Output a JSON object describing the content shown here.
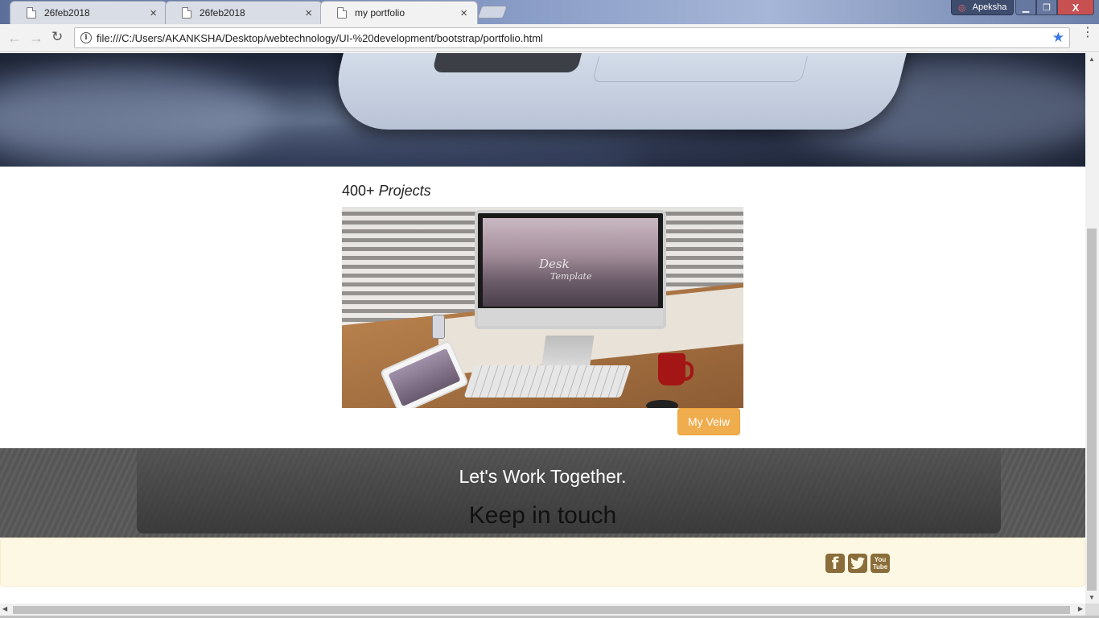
{
  "browser": {
    "tabs": [
      {
        "label": "26feb2018",
        "close": "×"
      },
      {
        "label": "26feb2018",
        "close": "×"
      },
      {
        "label": "my portfolio",
        "close": "×"
      }
    ],
    "profile_name": "Apeksha",
    "window_controls": {
      "minimize": "▁",
      "maximize": "❐",
      "close": "X"
    },
    "nav": {
      "back": "←",
      "forward": "→",
      "reload": "↻"
    },
    "url": "file:///C:/Users/AKANKSHA/Desktop/webtechnology/UI-%20development/bootstrap/portfolio.html",
    "bookmark_star": "★",
    "info_symbol": "i",
    "menu": "⋮"
  },
  "page": {
    "projects": {
      "count": "400+",
      "label": "Projects",
      "image_screen_text_1": "Desk",
      "image_screen_text_2": "Template"
    },
    "view_button": "My Veiw",
    "contact": {
      "heading": "Let's Work Together.",
      "subheading": "Keep in touch"
    },
    "social": {
      "facebook": "f",
      "twitter": "🐦",
      "youtube_top": "You",
      "youtube_bottom": "Tube"
    },
    "colors": {
      "button": "#f0ad4e",
      "footer_bg": "#fcf8e3",
      "social_icon": "#8a6d3b",
      "contact_band": "#5a5a5a"
    }
  },
  "scrollbars": {
    "up": "▲",
    "down": "▼",
    "left": "◀",
    "right": "▶"
  }
}
